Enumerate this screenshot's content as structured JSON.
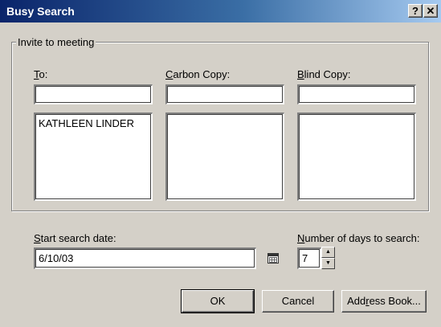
{
  "window": {
    "title": "Busy Search",
    "help_label": "?",
    "close_label": "✕"
  },
  "group": {
    "legend": "Invite to meeting"
  },
  "recipients": {
    "to": {
      "label_accel": "T",
      "label_rest": "o:",
      "input_value": "",
      "list_items": [
        "KATHLEEN LINDER"
      ]
    },
    "cc": {
      "label_accel": "C",
      "label_rest": "arbon Copy:",
      "input_value": "",
      "list_items": []
    },
    "bcc": {
      "label_accel": "B",
      "label_rest": "lind Copy:",
      "input_value": "",
      "list_items": []
    }
  },
  "start_date": {
    "label_accel": "S",
    "label_rest": "tart search date:",
    "value": "6/10/03",
    "icon": "calendar-icon"
  },
  "days": {
    "label_accel": "N",
    "label_rest": "umber of days to search:",
    "value": "7"
  },
  "buttons": {
    "ok": "OK",
    "cancel": "Cancel",
    "address_pre": "Add",
    "address_accel": "r",
    "address_post": "ess Book..."
  }
}
